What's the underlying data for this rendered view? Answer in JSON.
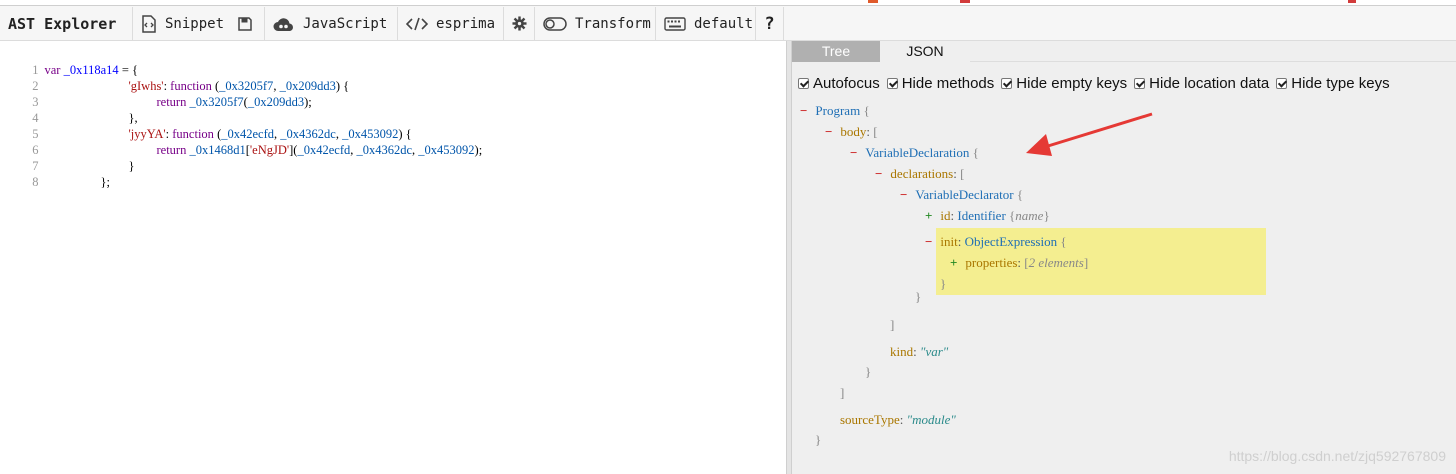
{
  "toolbar": {
    "title": "AST Explorer",
    "snippet_label": "Snippet",
    "language_label": "JavaScript",
    "parser_label": "esprima",
    "transform_label": "Transform",
    "keymap_label": "default",
    "help_label": "?"
  },
  "editor": {
    "lines": [
      {
        "n": "1"
      },
      {
        "n": "2"
      },
      {
        "n": "3"
      },
      {
        "n": "4"
      },
      {
        "n": "5"
      },
      {
        "n": "6"
      },
      {
        "n": "7"
      },
      {
        "n": "8"
      }
    ],
    "tokens": {
      "l1_kw": "var",
      "l1_var": "_0x118a14",
      "l1_rest": " = {",
      "l2_str": "'gIwhs'",
      "l2_colon": ": ",
      "l2_kw": "function",
      "l2_open": " (",
      "l2_p1": "_0x3205f7",
      "l2_comma": ", ",
      "l2_p2": "_0x209dd3",
      "l2_close": ") {",
      "l3_kw": "return",
      "l3_fn": "_0x3205f7",
      "l3_open": "(",
      "l3_arg": "_0x209dd3",
      "l3_close": ");",
      "l4": "},",
      "l5_str": "'jyyYA'",
      "l5_colon": ": ",
      "l5_kw": "function",
      "l5_open": " (",
      "l5_p1": "_0x42ecfd",
      "l5_c1": ", ",
      "l5_p2": "_0x4362dc",
      "l5_c2": ", ",
      "l5_p3": "_0x453092",
      "l5_close": ") {",
      "l6_kw": "return",
      "l6_obj": "_0x1468d1",
      "l6_lb": "[",
      "l6_str": "'eNgJD'",
      "l6_rb": "](",
      "l6_a1": "_0x42ecfd",
      "l6_c1": ", ",
      "l6_a2": "_0x4362dc",
      "l6_c2": ", ",
      "l6_a3": "_0x453092",
      "l6_close": ");",
      "l7": "}",
      "l8": "};"
    }
  },
  "output": {
    "tabs": [
      "Tree",
      "JSON"
    ],
    "options": [
      "Autofocus",
      "Hide methods",
      "Hide empty keys",
      "Hide location data",
      "Hide type keys"
    ],
    "tree": {
      "program": "Program",
      "body_key": "body",
      "var_decl": "VariableDeclaration",
      "declarations_key": "declarations",
      "var_declarator": "VariableDeclarator",
      "id_key": "id",
      "id_type": "Identifier",
      "id_summary": "name",
      "init_key": "init",
      "init_type": "ObjectExpression",
      "properties_key": "properties",
      "properties_summary": "2 elements",
      "kind_key": "kind",
      "kind_value": "\"var\"",
      "source_type_key": "sourceType",
      "source_type_value": "\"module\""
    }
  },
  "watermark": "https://blog.csdn.net/zjq592767809",
  "colors": {
    "arrow": "#e53935",
    "highlight": "#f4ee90",
    "active_tab": "#b0b0b0"
  }
}
